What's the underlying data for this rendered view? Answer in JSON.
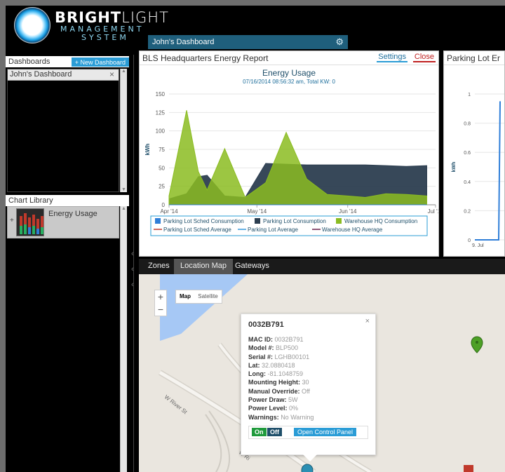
{
  "brand": {
    "name_bold": "BRIGHT",
    "name_light": "LIGHT",
    "line1": "MANAGEMENT",
    "line2": "SYSTEM"
  },
  "header": {
    "active_tab": "John's Dashboard"
  },
  "sidebar": {
    "dashboards_label": "Dashboards",
    "new_dashboard_label": "+ New Dashboard",
    "dashboard_items": [
      {
        "label": "John's Dashboard",
        "close": "×"
      }
    ],
    "chart_library_label": "Chart Library",
    "library_items": [
      {
        "label": "Energy Usage",
        "expand": "+"
      }
    ]
  },
  "energy_panel": {
    "title": "BLS Headquarters Energy Report",
    "settings_label": "Settings",
    "close_label": "Close"
  },
  "parking_panel": {
    "title": "Parking Lot Er"
  },
  "chart_data": [
    {
      "type": "area",
      "title": "Energy Usage",
      "subtitle": "07/16/2014 08:56:32 am, Total KW: 0",
      "xlabel": "",
      "ylabel": "kWh",
      "ylim": [
        0,
        150
      ],
      "yticks": [
        0,
        25,
        50,
        75,
        100,
        125,
        150
      ],
      "xticks": [
        "Apr '14",
        "May '14",
        "Jun '14",
        "Jul '14"
      ],
      "x": [
        "2014-04-01",
        "2014-04-07",
        "2014-04-11",
        "2014-04-14",
        "2014-04-20",
        "2014-04-27",
        "2014-05-04",
        "2014-05-11",
        "2014-05-18",
        "2014-05-25",
        "2014-06-01",
        "2014-06-07",
        "2014-06-14",
        "2014-06-21",
        "2014-06-28"
      ],
      "series": [
        {
          "name": "Parking Lot Sched Consumption",
          "color": "#2f7ed8",
          "values": [
            0,
            0,
            0,
            0,
            0,
            0,
            0,
            0,
            0,
            0,
            0,
            0,
            0,
            0,
            0
          ]
        },
        {
          "name": "Parking Lot Consumption",
          "color": "#2c3e50",
          "values": [
            8,
            15,
            38,
            40,
            12,
            10,
            56,
            55,
            54,
            54,
            54,
            54,
            53,
            52,
            53
          ]
        },
        {
          "name": "Warehouse HQ Consumption",
          "color": "#8bbc21",
          "values": [
            12,
            128,
            45,
            20,
            76,
            10,
            30,
            98,
            35,
            14,
            12,
            10,
            15,
            14,
            12
          ]
        },
        {
          "name": "Parking Lot Sched Average",
          "color": "#c0392b",
          "values": []
        },
        {
          "name": "Parking Lot Average",
          "color": "#3498db",
          "values": []
        },
        {
          "name": "Warehouse HQ Average",
          "color": "#6b1f4a",
          "values": []
        }
      ]
    },
    {
      "type": "line",
      "title": "",
      "ylabel": "kWh",
      "ylim": [
        0,
        1
      ],
      "yticks": [
        0,
        0.2,
        0.4,
        0.6,
        0.8,
        1
      ],
      "xticks": [
        "9. Jul"
      ],
      "x": [
        "2014-07-09",
        "2014-07-10"
      ],
      "series": [
        {
          "name": "",
          "color": "#2f7ed8",
          "values": [
            0,
            0.95
          ]
        }
      ]
    }
  ],
  "bottom_tabs": {
    "zones": "Zones",
    "location_map": "Location Map",
    "gateways": "Gateways"
  },
  "map": {
    "zoom_in": "+",
    "zoom_out": "−",
    "map_type": {
      "map": "Map",
      "satellite": "Satellite"
    },
    "streets": [
      "W River St",
      "W Ri"
    ],
    "popup": {
      "title": "0032B791",
      "close": "×",
      "rows": [
        {
          "label": "MAC ID:",
          "value": "0032B791"
        },
        {
          "label": "Model #:",
          "value": "BLP500"
        },
        {
          "label": "Serial #:",
          "value": "LGHB00101"
        },
        {
          "label": "Lat:",
          "value": "32.0880418"
        },
        {
          "label": "Long:",
          "value": "-81.1048759"
        },
        {
          "label": "Mounting Height:",
          "value": "30"
        },
        {
          "label": "Manual Override:",
          "value": "Off"
        },
        {
          "label": "Power Draw:",
          "value": "5W"
        },
        {
          "label": "Power Level:",
          "value": "0%"
        },
        {
          "label": "Warnings:",
          "value": "No Warning"
        }
      ],
      "on_label": "On",
      "off_label": "Off",
      "open_panel_label": "Open Control Panel"
    }
  }
}
